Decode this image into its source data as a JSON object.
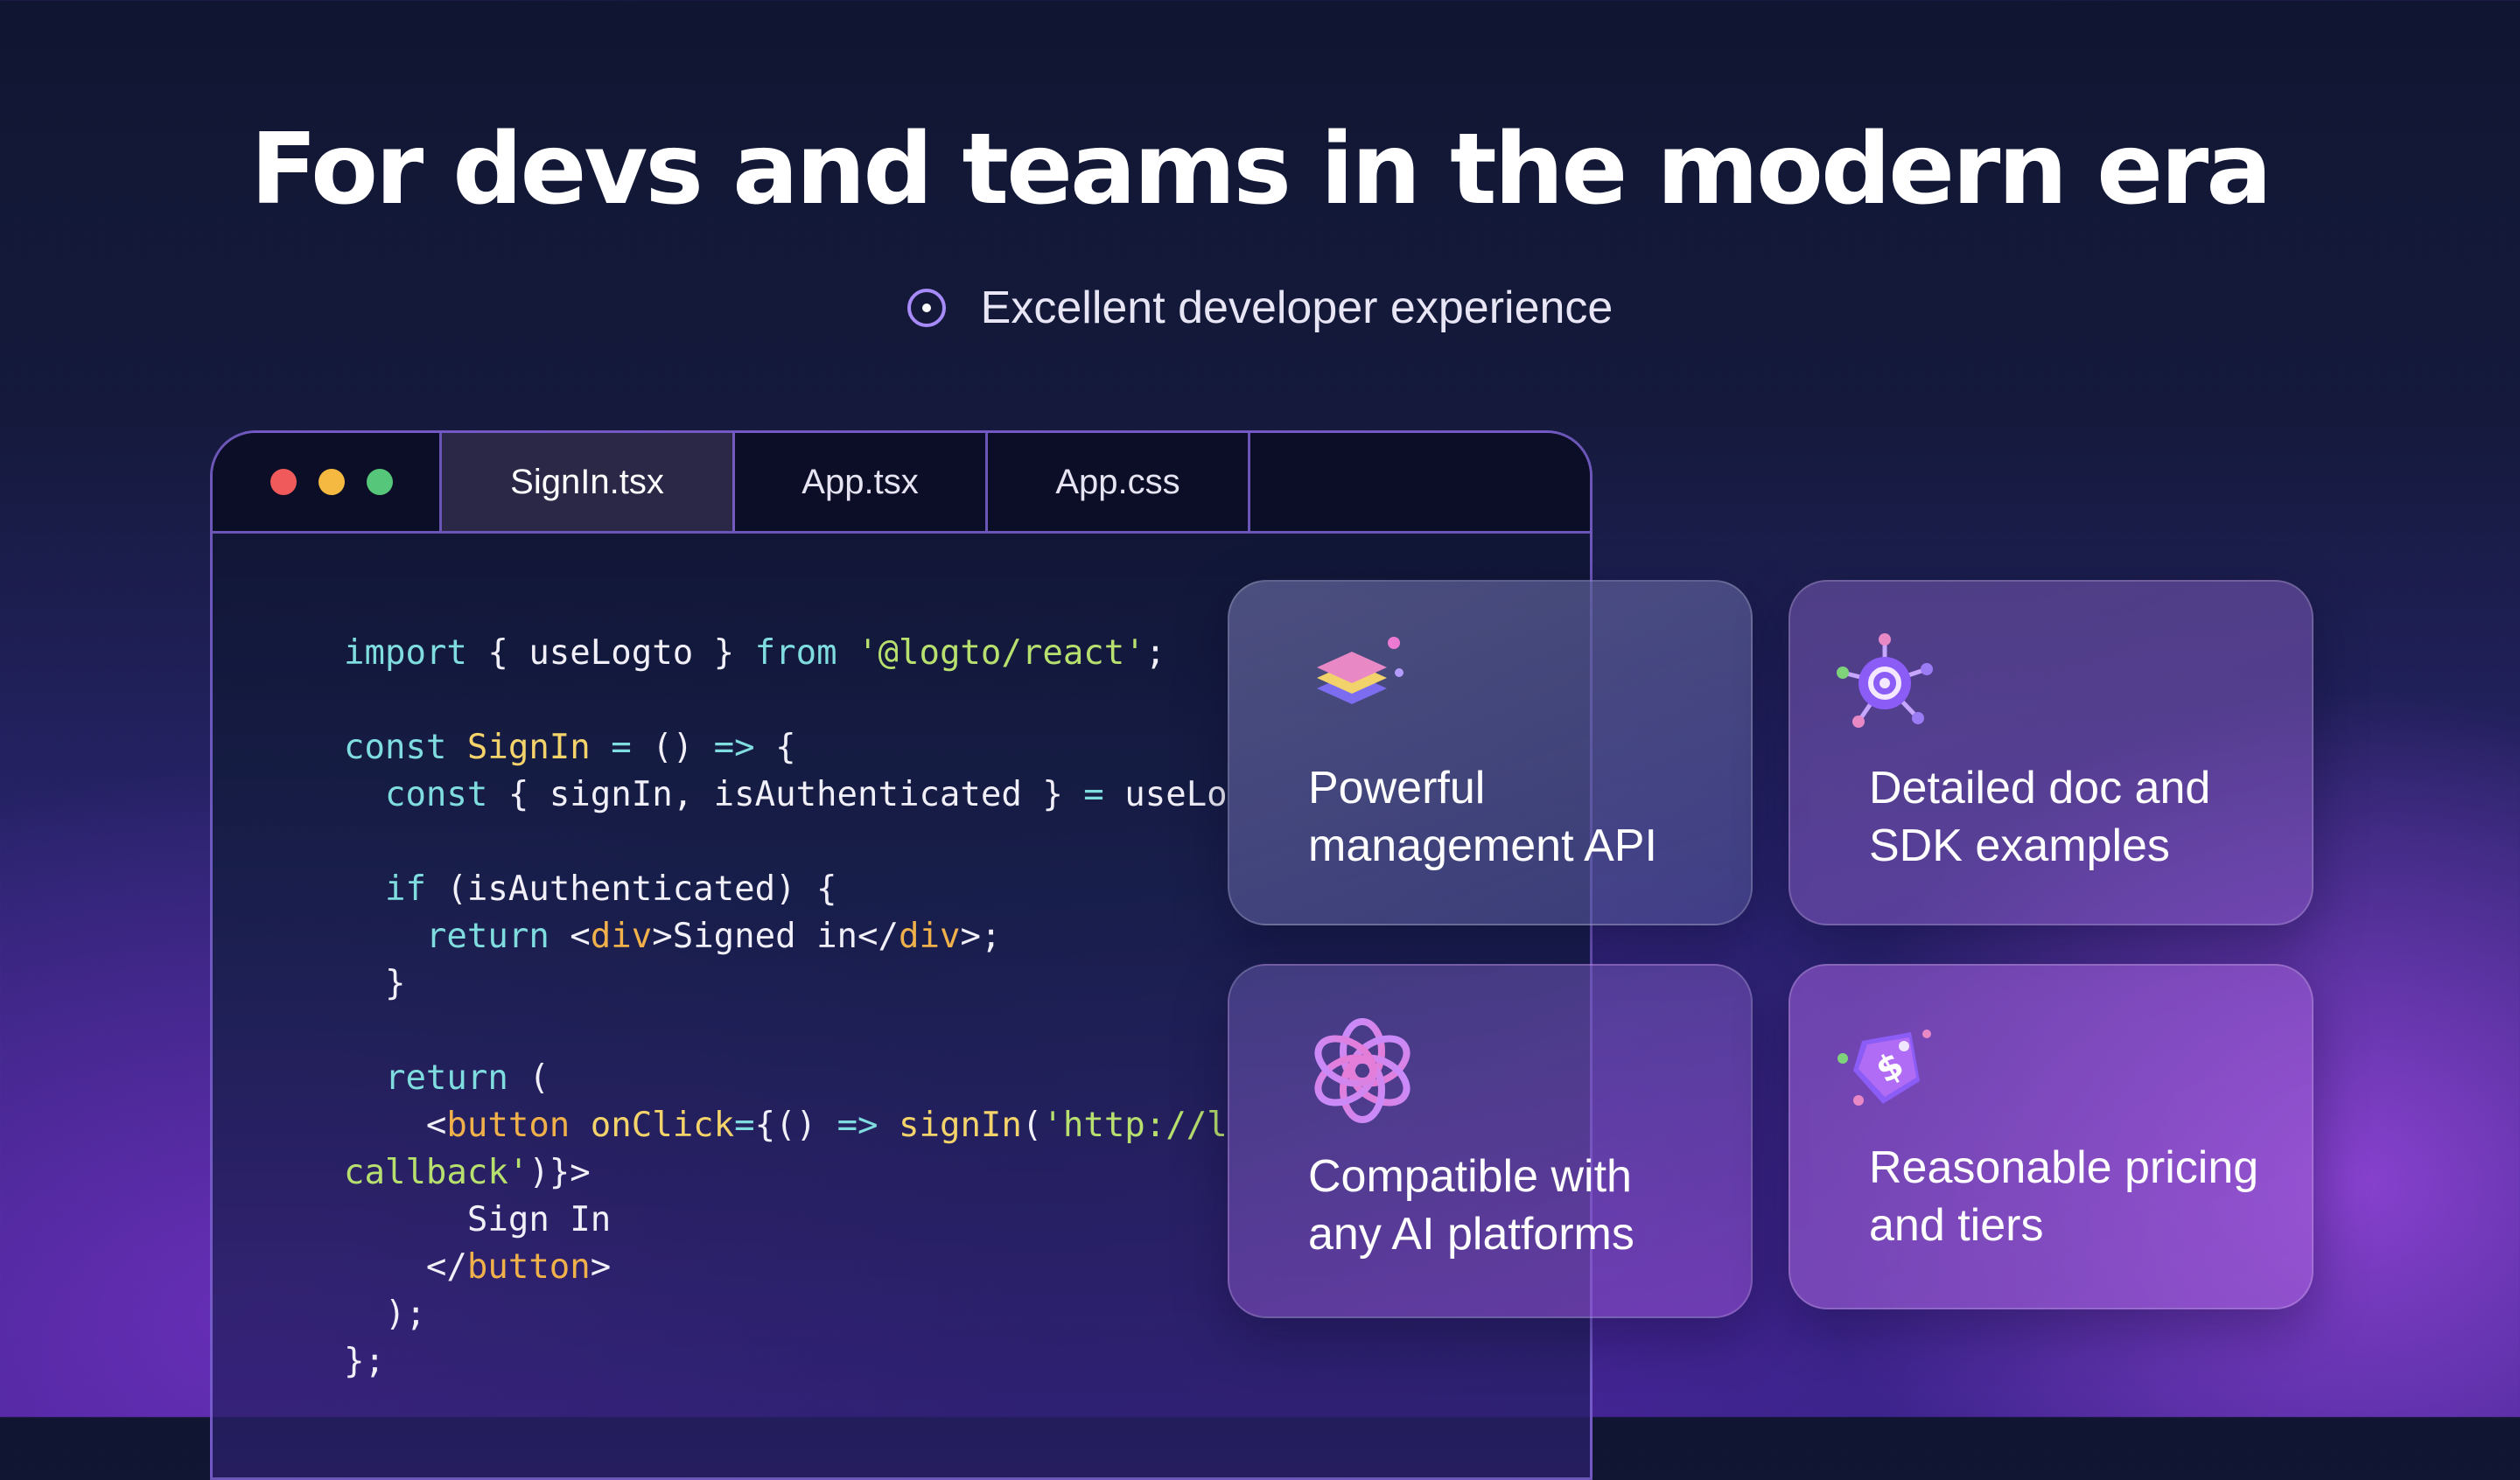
{
  "headline": "For devs and teams in the modern era",
  "subheading": "Excellent developer experience",
  "editor": {
    "tabs": [
      "SignIn.tsx",
      "App.tsx",
      "App.css"
    ],
    "active_tab": "SignIn.tsx",
    "code_lines": [
      "import { useLogto } from '@logto/react';",
      "",
      "const SignIn = () => {",
      "  const { signIn, isAuthenticated } = useLo",
      "",
      "  if (isAuthenticated) {",
      "    return <div>Signed in</div>;",
      "  }",
      "",
      "  return (",
      "    <button onClick={() => signIn('http://l",
      "callback')}>",
      "      Sign In",
      "    </button>",
      "  );",
      "};"
    ],
    "traffic_lights": [
      "#f05a5a",
      "#f5b841",
      "#55c67a"
    ]
  },
  "features": [
    {
      "label": "Powerful\nmanagement API",
      "icon": "layers-stack-icon"
    },
    {
      "label": "Detailed doc and\nSDK examples",
      "icon": "gear-network-icon"
    },
    {
      "label": "Compatible with\nany AI platforms",
      "icon": "openai-knot-icon"
    },
    {
      "label": "Reasonable pricing\nand tiers",
      "icon": "price-tag-icon"
    }
  ],
  "colors": {
    "accent": "#a78bfa",
    "keyword": "#7fdde0",
    "function": "#f4d36a",
    "string": "#b8e06e",
    "tag": "#f0b04a"
  }
}
